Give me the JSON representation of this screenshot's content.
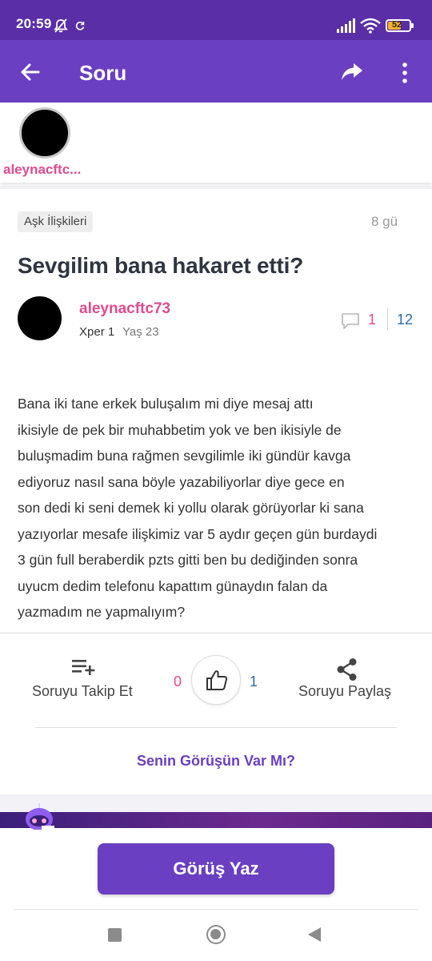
{
  "status_bar": {
    "time": "20:59",
    "battery": "52"
  },
  "app_bar": {
    "title": "Soru"
  },
  "followers": {
    "username": "aleynacftc..."
  },
  "question": {
    "category": "Aşk İlişkileri",
    "age": "8 gü",
    "title": "Sevgilim bana hakaret etti?",
    "author": {
      "name": "aleynacftc73",
      "level": "Xper 1",
      "age": "Yaş 23"
    },
    "stats": {
      "comments": "1",
      "views": "12"
    },
    "body_lines": [
      "Bana iki tane erkek buluşalım mi diye mesaj attı",
      "ikisiyle de pek bir muhabbetim yok ve ben ikisiyle de",
      "buluşmadim buna rağmen sevgilimle iki gündür kavga",
      "ediyoruz nasıl sana böyle yazabiliyorlar diye gece en",
      "son dedi ki seni demek ki yollu olarak görüyorlar ki sana",
      "yazıyorlar mesafe ilişkimiz var 5 aydır geçen gün burdaydi",
      "3 gün full beraberdik pzts gitti ben bu dediğinden sonra",
      "uyucm dedim telefonu kapattım günaydın falan da",
      "yazmadım ne yapmalıyım?"
    ]
  },
  "actions": {
    "follow_label": "Soruyu Takip Et",
    "vote_down": "0",
    "vote_up": "1",
    "share_label": "Soruyu Paylaş"
  },
  "opinion_prompt": "Senin Görüşün Var Mı?",
  "cta_label": "Görüş Yaz",
  "colors": {
    "primary": "#6a3fc2",
    "status_bar": "#5a2ea6",
    "username_pink": "#e04b8e",
    "count_blue": "#2e6aa8"
  }
}
